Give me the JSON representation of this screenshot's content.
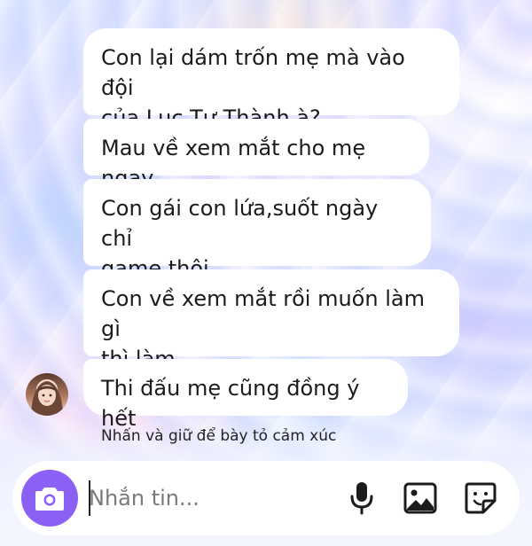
{
  "messages": [
    {
      "text": "Con lại dám trốn mẹ mà vào đội\ncủa Lục Tư Thành à?"
    },
    {
      "text": "Mau về xem mắt cho mẹ ngay"
    },
    {
      "text": "Con gái con lứa,suốt ngày chỉ\ngame thôi"
    },
    {
      "text": "Con về xem mắt rồi muốn làm gì\nthì làm"
    },
    {
      "text": "Thi đấu mẹ cũng đồng ý hết"
    }
  ],
  "reaction_hint": "Nhấn và giữ để bày tỏ cảm xúc",
  "composer": {
    "placeholder": "Nhắn tin...",
    "value": "",
    "camera_icon": "camera-icon",
    "mic_icon": "microphone-icon",
    "gallery_icon": "image-gallery-icon",
    "sticker_icon": "sticker-icon"
  },
  "colors": {
    "accent": "#8a60f5",
    "bubble": "#ffffff",
    "text": "#1b1b1b"
  }
}
